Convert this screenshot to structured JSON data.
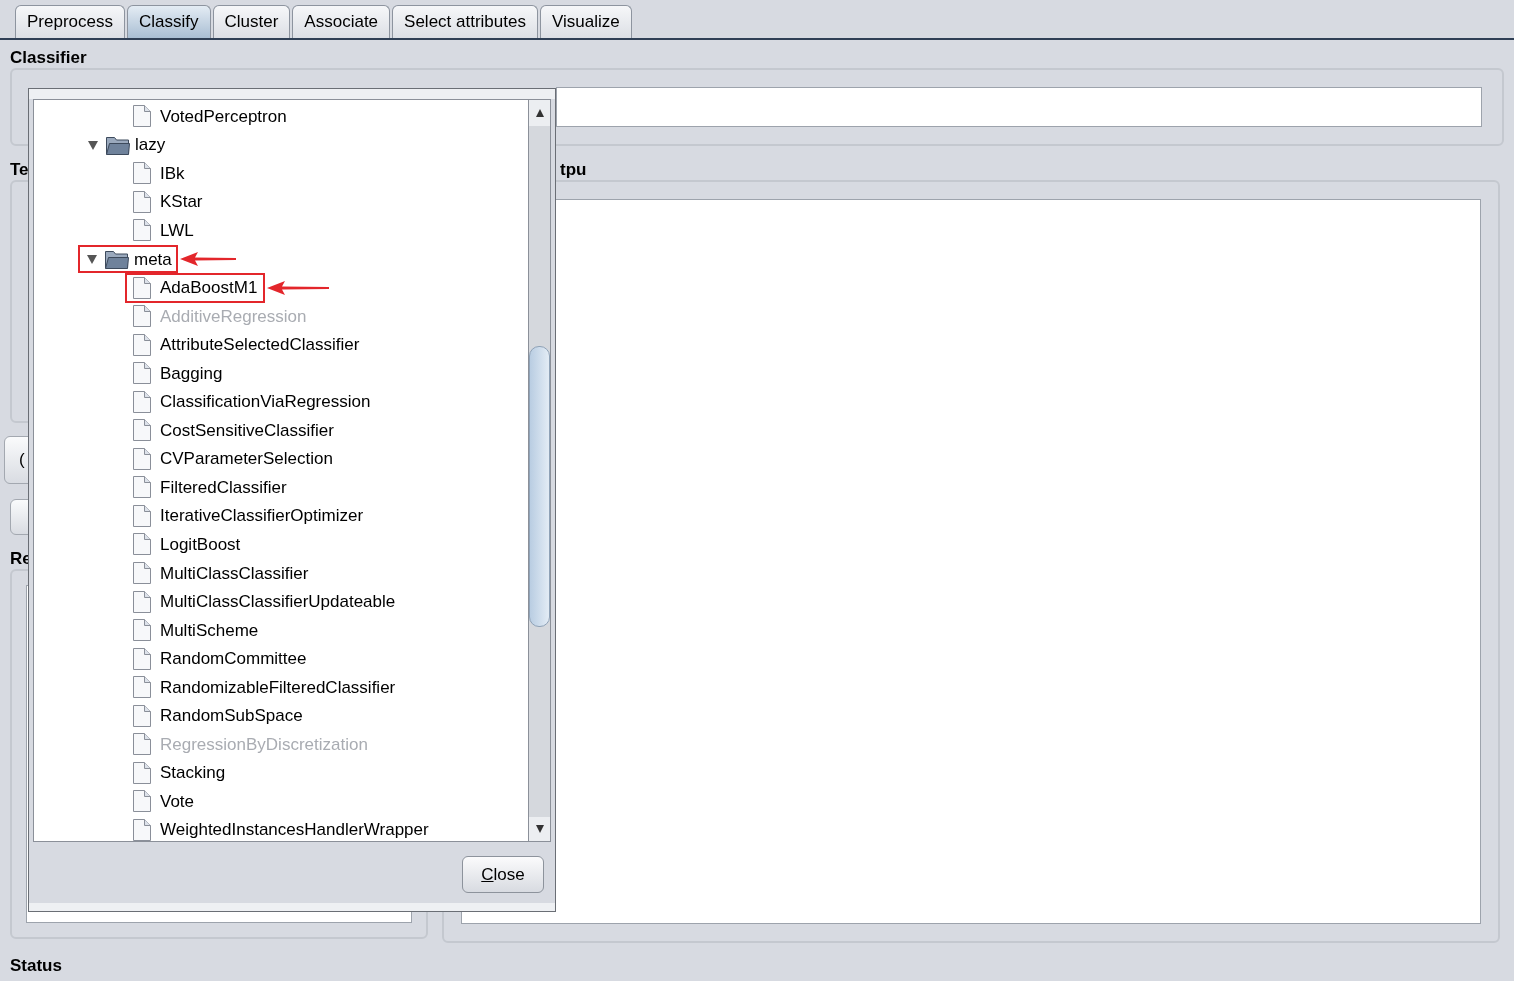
{
  "tabs": [
    {
      "label": "Preprocess",
      "selected": false
    },
    {
      "label": "Classify",
      "selected": true
    },
    {
      "label": "Cluster",
      "selected": false
    },
    {
      "label": "Associate",
      "selected": false
    },
    {
      "label": "Select attributes",
      "selected": false
    },
    {
      "label": "Visualize",
      "selected": false
    }
  ],
  "classifier_section": {
    "title": "Classifier"
  },
  "left_panel": {
    "title_fragment": "Te",
    "button_fragment": "(",
    "results_fragment": "Re"
  },
  "output_panel": {
    "title_fragment": "tpu"
  },
  "status_section": {
    "title": "Status"
  },
  "chooser": {
    "tree": [
      {
        "kind": "leaf",
        "label": "VotedPerceptron",
        "disabled": false,
        "highlighted": false
      },
      {
        "kind": "folder",
        "label": "lazy",
        "expanded": true,
        "highlighted": false,
        "children": [
          {
            "kind": "leaf",
            "label": "IBk",
            "disabled": false,
            "highlighted": false
          },
          {
            "kind": "leaf",
            "label": "KStar",
            "disabled": false,
            "highlighted": false
          },
          {
            "kind": "leaf",
            "label": "LWL",
            "disabled": false,
            "highlighted": false
          }
        ]
      },
      {
        "kind": "folder",
        "label": "meta",
        "expanded": true,
        "highlighted": true,
        "children": [
          {
            "kind": "leaf",
            "label": "AdaBoostM1",
            "disabled": false,
            "highlighted": true
          },
          {
            "kind": "leaf",
            "label": "AdditiveRegression",
            "disabled": true,
            "highlighted": false
          },
          {
            "kind": "leaf",
            "label": "AttributeSelectedClassifier",
            "disabled": false,
            "highlighted": false
          },
          {
            "kind": "leaf",
            "label": "Bagging",
            "disabled": false,
            "highlighted": false
          },
          {
            "kind": "leaf",
            "label": "ClassificationViaRegression",
            "disabled": false,
            "highlighted": false
          },
          {
            "kind": "leaf",
            "label": "CostSensitiveClassifier",
            "disabled": false,
            "highlighted": false
          },
          {
            "kind": "leaf",
            "label": "CVParameterSelection",
            "disabled": false,
            "highlighted": false
          },
          {
            "kind": "leaf",
            "label": "FilteredClassifier",
            "disabled": false,
            "highlighted": false
          },
          {
            "kind": "leaf",
            "label": "IterativeClassifierOptimizer",
            "disabled": false,
            "highlighted": false
          },
          {
            "kind": "leaf",
            "label": "LogitBoost",
            "disabled": false,
            "highlighted": false
          },
          {
            "kind": "leaf",
            "label": "MultiClassClassifier",
            "disabled": false,
            "highlighted": false
          },
          {
            "kind": "leaf",
            "label": "MultiClassClassifierUpdateable",
            "disabled": false,
            "highlighted": false
          },
          {
            "kind": "leaf",
            "label": "MultiScheme",
            "disabled": false,
            "highlighted": false
          },
          {
            "kind": "leaf",
            "label": "RandomCommittee",
            "disabled": false,
            "highlighted": false
          },
          {
            "kind": "leaf",
            "label": "RandomizableFilteredClassifier",
            "disabled": false,
            "highlighted": false
          },
          {
            "kind": "leaf",
            "label": "RandomSubSpace",
            "disabled": false,
            "highlighted": false
          },
          {
            "kind": "leaf",
            "label": "RegressionByDiscretization",
            "disabled": true,
            "highlighted": false
          },
          {
            "kind": "leaf",
            "label": "Stacking",
            "disabled": false,
            "highlighted": false
          },
          {
            "kind": "leaf",
            "label": "Vote",
            "disabled": false,
            "highlighted": false
          },
          {
            "kind": "leaf",
            "label": "WeightedInstancesHandlerWrapper",
            "disabled": false,
            "highlighted": false
          }
        ]
      }
    ],
    "close_button": {
      "mnemonic": "C",
      "rest": "lose"
    }
  }
}
